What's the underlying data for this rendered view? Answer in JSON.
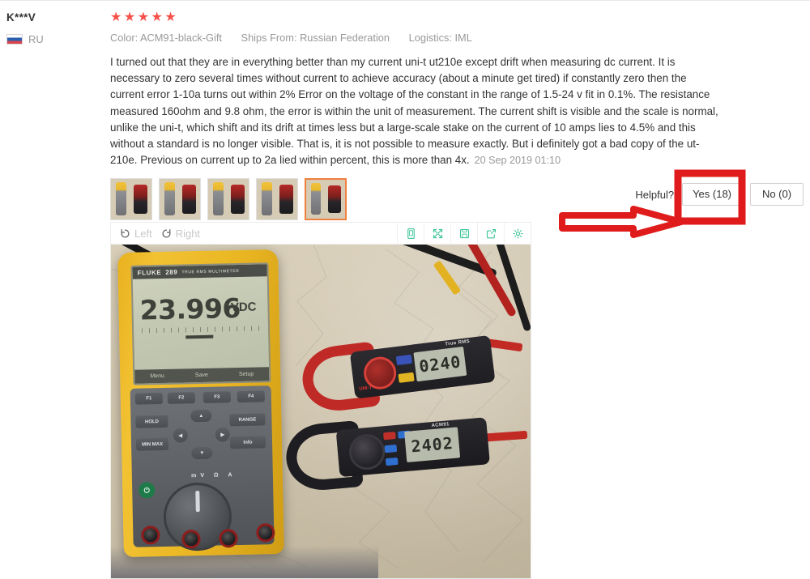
{
  "reviewer": {
    "name": "K***V",
    "country_code": "RU",
    "flag_icon": "russia-flag-icon"
  },
  "review": {
    "rating": 5,
    "stars_glyph": "★★★★★",
    "attributes": [
      "Color: ACM91-black-Gift",
      "Ships From: Russian Federation",
      "Logistics: IML"
    ],
    "body": "I turned out that they are in everything better than my current uni-t ut210e except drift when measuring dc current. It is necessary to zero several times without current to achieve accuracy (about a minute get tired) if constantly zero then the current error 1-10a turns out within 2% Error on the voltage of the constant in the range of 1.5-24 v fit in 0.1%. The resistance measured 160ohm and 9.8 ohm, the error is within the unit of measurement. The current shift is visible and the scale is normal, unlike the uni-t, which shift and its drift at times less but a large-scale stake on the current of 10 amps lies to 4.5% and this without a standard is no longer visible. That is, it is not possible to measure exactly. But i definitely got a bad copy of the ut-210e. Previous on current up to 2a lied within percent, this is more than 4x.",
    "date": "20 Sep 2019 01:10"
  },
  "helpful": {
    "label": "Helpful?",
    "yes_label": "Yes (18)",
    "no_label": "No (0)"
  },
  "thumbnails": [
    {
      "alt": "review-photo-1",
      "selected": false
    },
    {
      "alt": "review-photo-2",
      "selected": false
    },
    {
      "alt": "review-photo-3",
      "selected": false
    },
    {
      "alt": "review-photo-4",
      "selected": false
    },
    {
      "alt": "review-photo-5",
      "selected": true
    }
  ],
  "viewer": {
    "rotate_left_label": "Left",
    "rotate_right_label": "Right",
    "tools": [
      {
        "icon": "mobile-device-icon"
      },
      {
        "icon": "fullscreen-expand-icon"
      },
      {
        "icon": "save-floppy-icon"
      },
      {
        "icon": "share-export-icon"
      },
      {
        "icon": "settings-gear-icon"
      }
    ]
  },
  "photo": {
    "fluke": {
      "brand": "FLUKE",
      "model": "289",
      "model_suffix": "TRUE RMS MULTIMETER",
      "reading": "23.996",
      "unit": "VDC",
      "softkeys": [
        "Menu",
        "Save",
        "Setup"
      ],
      "fkeys": [
        "F1",
        "F2",
        "F3",
        "F4"
      ],
      "left_keys": [
        "HOLD",
        "MIN MAX"
      ],
      "right_keys": [
        "RANGE",
        "Info"
      ]
    },
    "clamp_red": {
      "brand": "UNI-T",
      "reading": "0240",
      "badge": "True RMS"
    },
    "clamp_black": {
      "model": "ACM91",
      "reading": "2402"
    }
  },
  "annotation": {
    "box_color": "#e01b1b",
    "arrow_color": "#e01b1b",
    "target": "yes-vote-button"
  },
  "colors": {
    "star": "#f5504a",
    "accent_green": "#3ec49a",
    "thumb_selected": "#f08040",
    "muted_text": "#999999"
  }
}
